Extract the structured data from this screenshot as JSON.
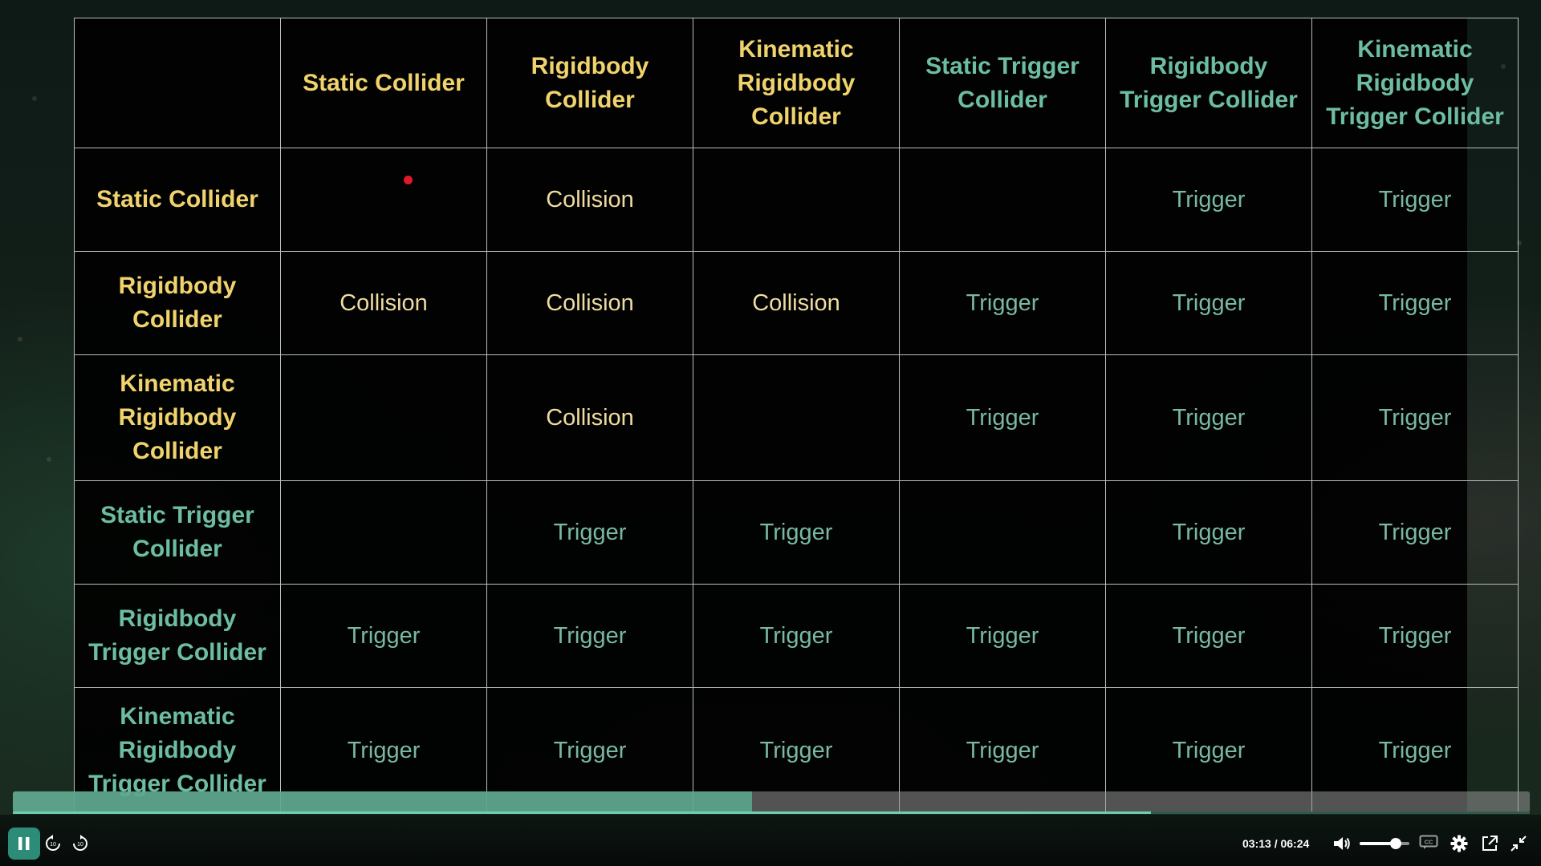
{
  "table": {
    "corner": "",
    "column_headers": [
      {
        "label": "Static Collider",
        "color": "yellow"
      },
      {
        "label": "Rigidbody Collider",
        "color": "yellow"
      },
      {
        "label": "Kinematic Rigidbody Collider",
        "color": "yellow"
      },
      {
        "label": "Static Trigger Collider",
        "color": "teal"
      },
      {
        "label": "Rigidbody Trigger Collider",
        "color": "teal"
      },
      {
        "label": "Kinematic Rigidbody Trigger Collider",
        "color": "teal"
      }
    ],
    "rows": [
      {
        "header": "Static Collider",
        "color": "yellow",
        "cells": [
          "",
          "Collision",
          "",
          "",
          "Trigger",
          "Trigger"
        ]
      },
      {
        "header": "Rigidbody Collider",
        "color": "yellow",
        "cells": [
          "Collision",
          "Collision",
          "Collision",
          "Trigger",
          "Trigger",
          "Trigger"
        ]
      },
      {
        "header": "Kinematic Rigidbody Collider",
        "color": "yellow",
        "cells": [
          "",
          "Collision",
          "",
          "Trigger",
          "Trigger",
          "Trigger"
        ]
      },
      {
        "header": "Static Trigger Collider",
        "color": "teal",
        "cells": [
          "",
          "Trigger",
          "Trigger",
          "",
          "Trigger",
          "Trigger"
        ]
      },
      {
        "header": "Rigidbody Trigger Collider",
        "color": "teal",
        "cells": [
          "Trigger",
          "Trigger",
          "Trigger",
          "Trigger",
          "Trigger",
          "Trigger"
        ]
      },
      {
        "header": "Kinematic Rigidbody Trigger Collider",
        "color": "teal",
        "cells": [
          "Trigger",
          "Trigger",
          "Trigger",
          "Trigger",
          "Trigger",
          "Trigger"
        ]
      }
    ]
  },
  "colors": {
    "header_yellow": "#f1d36d",
    "header_teal": "#6dbda3",
    "accent": "#2d8c77"
  },
  "player": {
    "current_time": "03:13",
    "separator": "/",
    "duration": "06:24",
    "progress_fraction": 0.4973,
    "volume_fraction": 0.72,
    "icons": {
      "play_pause": "pause-icon",
      "rewind": "rewind-10-icon",
      "forward": "forward-10-icon",
      "volume": "volume-icon",
      "captions": "captions-icon",
      "settings": "gear-icon",
      "popout": "popout-icon",
      "fullscreen": "exit-fullscreen-icon"
    }
  }
}
